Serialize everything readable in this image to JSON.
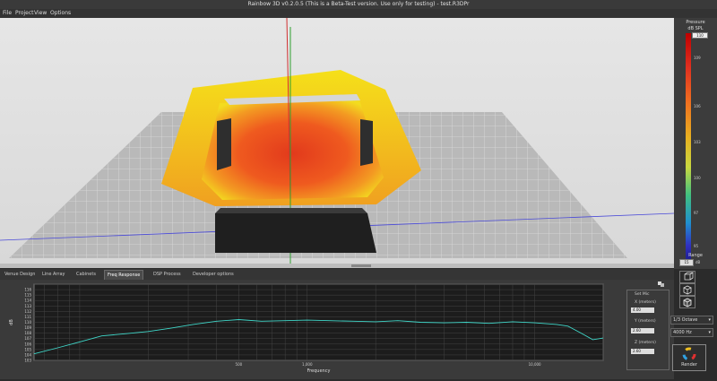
{
  "window": {
    "title": "Rainbow 3D v0.2.0.5   (This is a Beta-Test version. Use only for testing)   -   test.R3DPr"
  },
  "menu": [
    "File",
    "Project",
    "View",
    "Options"
  ],
  "legend": {
    "title": "Pressure",
    "unit": "dB SPL",
    "max": "110",
    "min": "95",
    "range_label": "Range",
    "range_value": "15",
    "range_unit": "dB",
    "ticks": [
      "109",
      "106",
      "103",
      "100",
      "97",
      "95"
    ]
  },
  "tabs": [
    "Venue Design",
    "Line Array",
    "Cabinets",
    "Freq Response",
    "DSP Process",
    "Developer options"
  ],
  "active_tab": "Freq Response",
  "set_mic": {
    "title": "Set Mic",
    "x_label": "X (meters)",
    "x_value": "4.00",
    "y_label": "Y (meters)",
    "y_value": "2.60",
    "z_label": "Z (meters)",
    "z_value": "2.60"
  },
  "octave_select": "1/3 Octave",
  "freq_select": "4000 Hz",
  "render_label": "Render",
  "chart_data": {
    "type": "line",
    "title": "",
    "xlabel": "Frequency",
    "ylabel": "dB",
    "xscale": "log",
    "xlim": [
      63,
      20000
    ],
    "ylim": [
      103,
      117
    ],
    "xticks": [
      "500",
      "1,000",
      "10,000"
    ],
    "yticks": [
      "116",
      "115",
      "114",
      "113",
      "112",
      "111",
      "110",
      "109",
      "108",
      "107",
      "106",
      "105",
      "104",
      "103"
    ],
    "series": [
      {
        "color": "#3fd6c8",
        "x": [
          63,
          80,
          100,
          125,
          160,
          200,
          250,
          315,
          400,
          500,
          630,
          800,
          1000,
          1250,
          1600,
          2000,
          2500,
          3150,
          4000,
          5000,
          6300,
          8000,
          10000,
          12500,
          14000,
          16000,
          18000,
          20000
        ],
        "y": [
          104.2,
          105.3,
          106.4,
          107.5,
          107.9,
          108.3,
          108.9,
          109.6,
          110.2,
          110.5,
          110.2,
          110.3,
          110.4,
          110.3,
          110.2,
          110.1,
          110.3,
          110.0,
          109.9,
          110.0,
          109.8,
          110.1,
          109.9,
          109.6,
          109.3,
          108.0,
          106.8,
          107.1
        ]
      }
    ]
  }
}
